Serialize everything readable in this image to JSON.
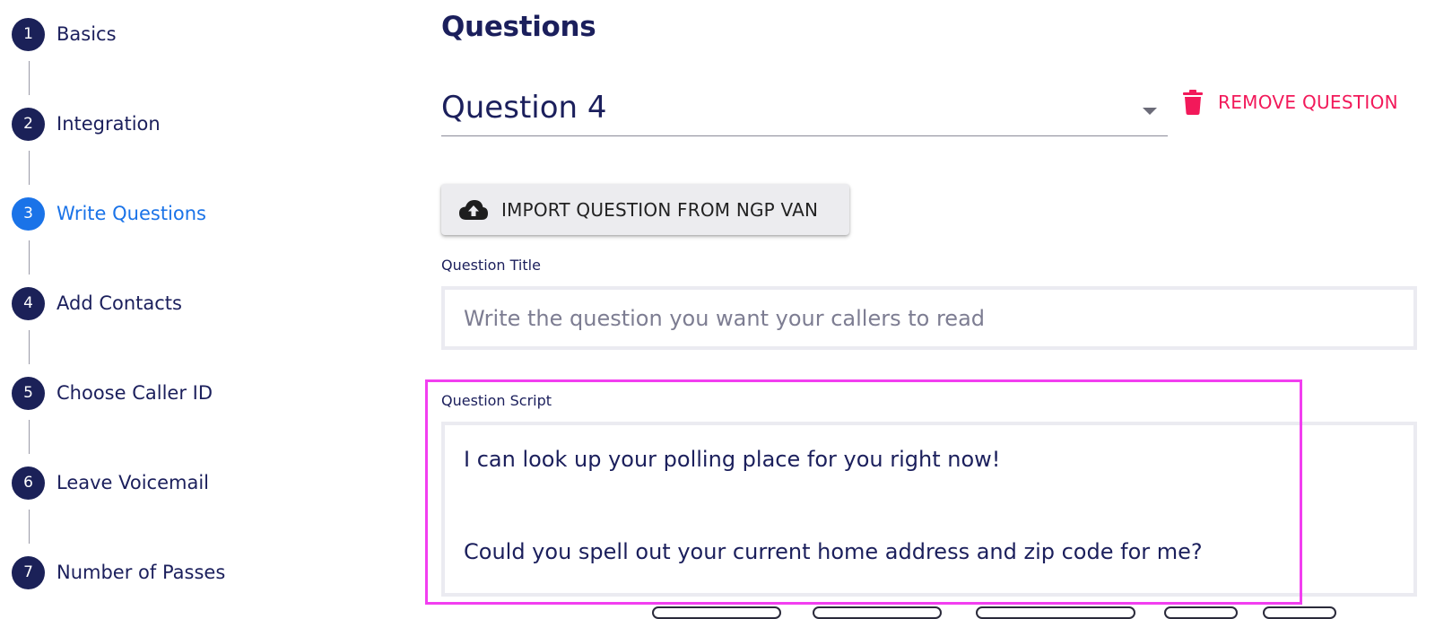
{
  "stepper": {
    "steps": [
      {
        "number": "1",
        "label": "Basics"
      },
      {
        "number": "2",
        "label": "Integration"
      },
      {
        "number": "3",
        "label": "Write Questions"
      },
      {
        "number": "4",
        "label": "Add Contacts"
      },
      {
        "number": "5",
        "label": "Choose Caller ID"
      },
      {
        "number": "6",
        "label": "Leave Voicemail"
      },
      {
        "number": "7",
        "label": "Number of Passes"
      }
    ],
    "active_step": "3"
  },
  "page": {
    "title": "Questions"
  },
  "question_select": {
    "value": "Question 4"
  },
  "remove_question": {
    "label": "REMOVE QUESTION",
    "icon": "trash-icon"
  },
  "import_button": {
    "label": "IMPORT QUESTION FROM NGP VAN",
    "icon": "cloud-upload-icon"
  },
  "question_title": {
    "label": "Question Title",
    "value": "",
    "placeholder": "Write the question you want your callers to read"
  },
  "question_script": {
    "label": "Question Script",
    "lines": [
      "I can look up your polling place for you right now!",
      "Could you spell out your current home address and zip code for me?"
    ]
  },
  "colors": {
    "navy": "#1b1f5c",
    "active_blue": "#1a73e8",
    "danger": "#f2195a",
    "highlight": "#f23ef0"
  }
}
